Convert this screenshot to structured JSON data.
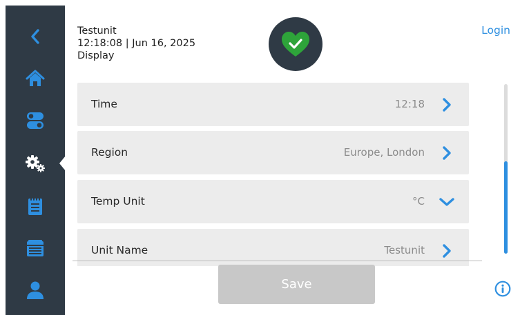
{
  "header": {
    "unit_name": "Testunit",
    "datetime": "12:18:08 | Jun 16, 2025",
    "page_title": "Display",
    "login_label": "Login",
    "status_icon": "heart-check-icon"
  },
  "sidebar": {
    "items": [
      {
        "name": "back",
        "icon": "chevron-left-icon"
      },
      {
        "name": "home",
        "icon": "home-icon"
      },
      {
        "name": "controls",
        "icon": "toggle-icon"
      },
      {
        "name": "settings",
        "icon": "gears-icon",
        "active": true
      },
      {
        "name": "log",
        "icon": "notepad-icon"
      },
      {
        "name": "calendar",
        "icon": "calendar-icon"
      },
      {
        "name": "user",
        "icon": "user-icon"
      }
    ]
  },
  "settings": {
    "rows": [
      {
        "label": "Time",
        "value": "12:18",
        "control": "chevron-right-icon"
      },
      {
        "label": "Region",
        "value": "Europe, London",
        "control": "chevron-right-icon"
      },
      {
        "label": "Temp Unit",
        "value": "°C",
        "control": "chevron-down-icon"
      },
      {
        "label": "Unit Name",
        "value": "Testunit",
        "control": "chevron-right-icon"
      }
    ]
  },
  "footer": {
    "save_label": "Save",
    "info_icon": "info-icon"
  },
  "colors": {
    "sidebar": "#2f3a45",
    "accent": "#2e8fe0",
    "status_ok": "#2ea43a",
    "row_bg": "#ececec",
    "save_disabled": "#c8c8c8"
  }
}
